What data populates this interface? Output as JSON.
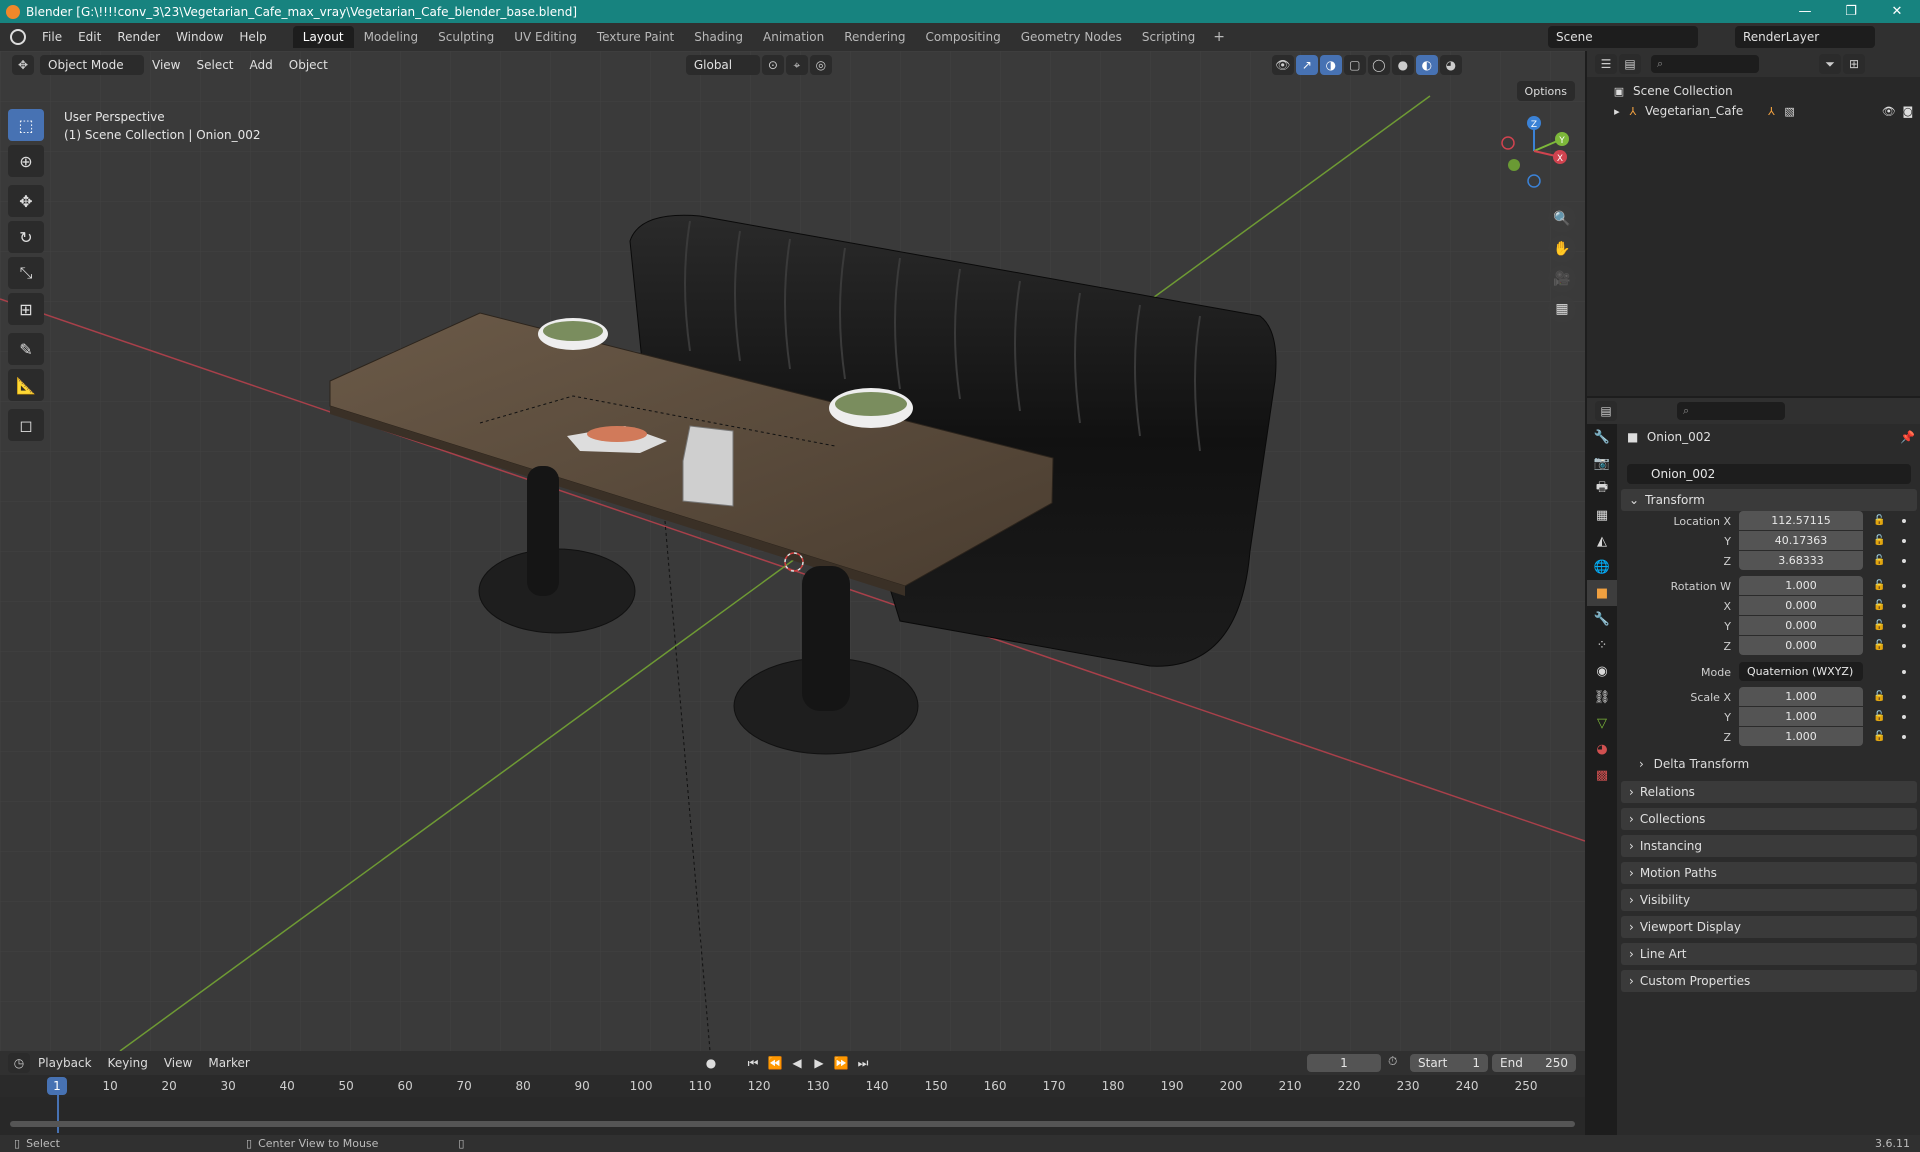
{
  "titlebar": {
    "title": "Blender [G:\\!!!!conv_3\\23\\Vegetarian_Cafe_max_vray\\Vegetarian_Cafe_blender_base.blend]",
    "minimize": "—",
    "maximize": "❐",
    "close": "✕"
  },
  "menubar": {
    "items": [
      "File",
      "Edit",
      "Render",
      "Window",
      "Help"
    ],
    "workspaces": [
      "Layout",
      "Modeling",
      "Sculpting",
      "UV Editing",
      "Texture Paint",
      "Shading",
      "Animation",
      "Rendering",
      "Compositing",
      "Geometry Nodes",
      "Scripting"
    ],
    "active_workspace": "Layout",
    "add": "+",
    "scene": "Scene",
    "view_layer": "RenderLayer"
  },
  "viewport": {
    "mode": "Object Mode",
    "menus": [
      "View",
      "Select",
      "Add",
      "Object"
    ],
    "orientation": "Global",
    "options": "Options",
    "perspective": "User Perspective",
    "collection_path": "(1) Scene Collection | Onion_002",
    "gizmo": {
      "x": "X",
      "y": "Y",
      "z": "Z"
    }
  },
  "timeline": {
    "menus": [
      "Playback",
      "Keying",
      "View",
      "Marker"
    ],
    "current_frame": "1",
    "start_label": "Start",
    "start": "1",
    "end_label": "End",
    "end": "250",
    "ticks": [
      "10",
      "20",
      "30",
      "40",
      "50",
      "60",
      "70",
      "80",
      "90",
      "100",
      "110",
      "120",
      "130",
      "140",
      "150",
      "160",
      "170",
      "180",
      "190",
      "200",
      "210",
      "220",
      "230",
      "240",
      "250"
    ],
    "playhead": "1"
  },
  "statusbar": {
    "select": "Select",
    "center": "Center View to Mouse",
    "version": "3.6.11"
  },
  "outliner": {
    "scene_collection": "Scene Collection",
    "item": "Vegetarian_Cafe"
  },
  "properties": {
    "object_name": "Onion_002",
    "name_field": "Onion_002",
    "transform": {
      "title": "Transform",
      "location_label": "Location X",
      "location": [
        "112.57115",
        "40.17363",
        "3.68333"
      ],
      "rotation_label": "Rotation W",
      "rotation": [
        "1.000",
        "0.000",
        "0.000",
        "0.000"
      ],
      "mode_label": "Mode",
      "mode": "Quaternion (WXYZ)",
      "scale_label": "Scale X",
      "scale": [
        "1.000",
        "1.000",
        "1.000"
      ],
      "y_label": "Y",
      "z_label": "Z",
      "x_label": "X"
    },
    "delta_transform": "Delta Transform",
    "panels": [
      "Relations",
      "Collections",
      "Instancing",
      "Motion Paths",
      "Visibility",
      "Viewport Display",
      "Line Art",
      "Custom Properties"
    ]
  },
  "colors": {
    "accent": "#4772b3",
    "titlebar": "#17837f",
    "x_axis": "#d0434f",
    "y_axis": "#7db83a",
    "z_axis": "#3b82d6"
  }
}
